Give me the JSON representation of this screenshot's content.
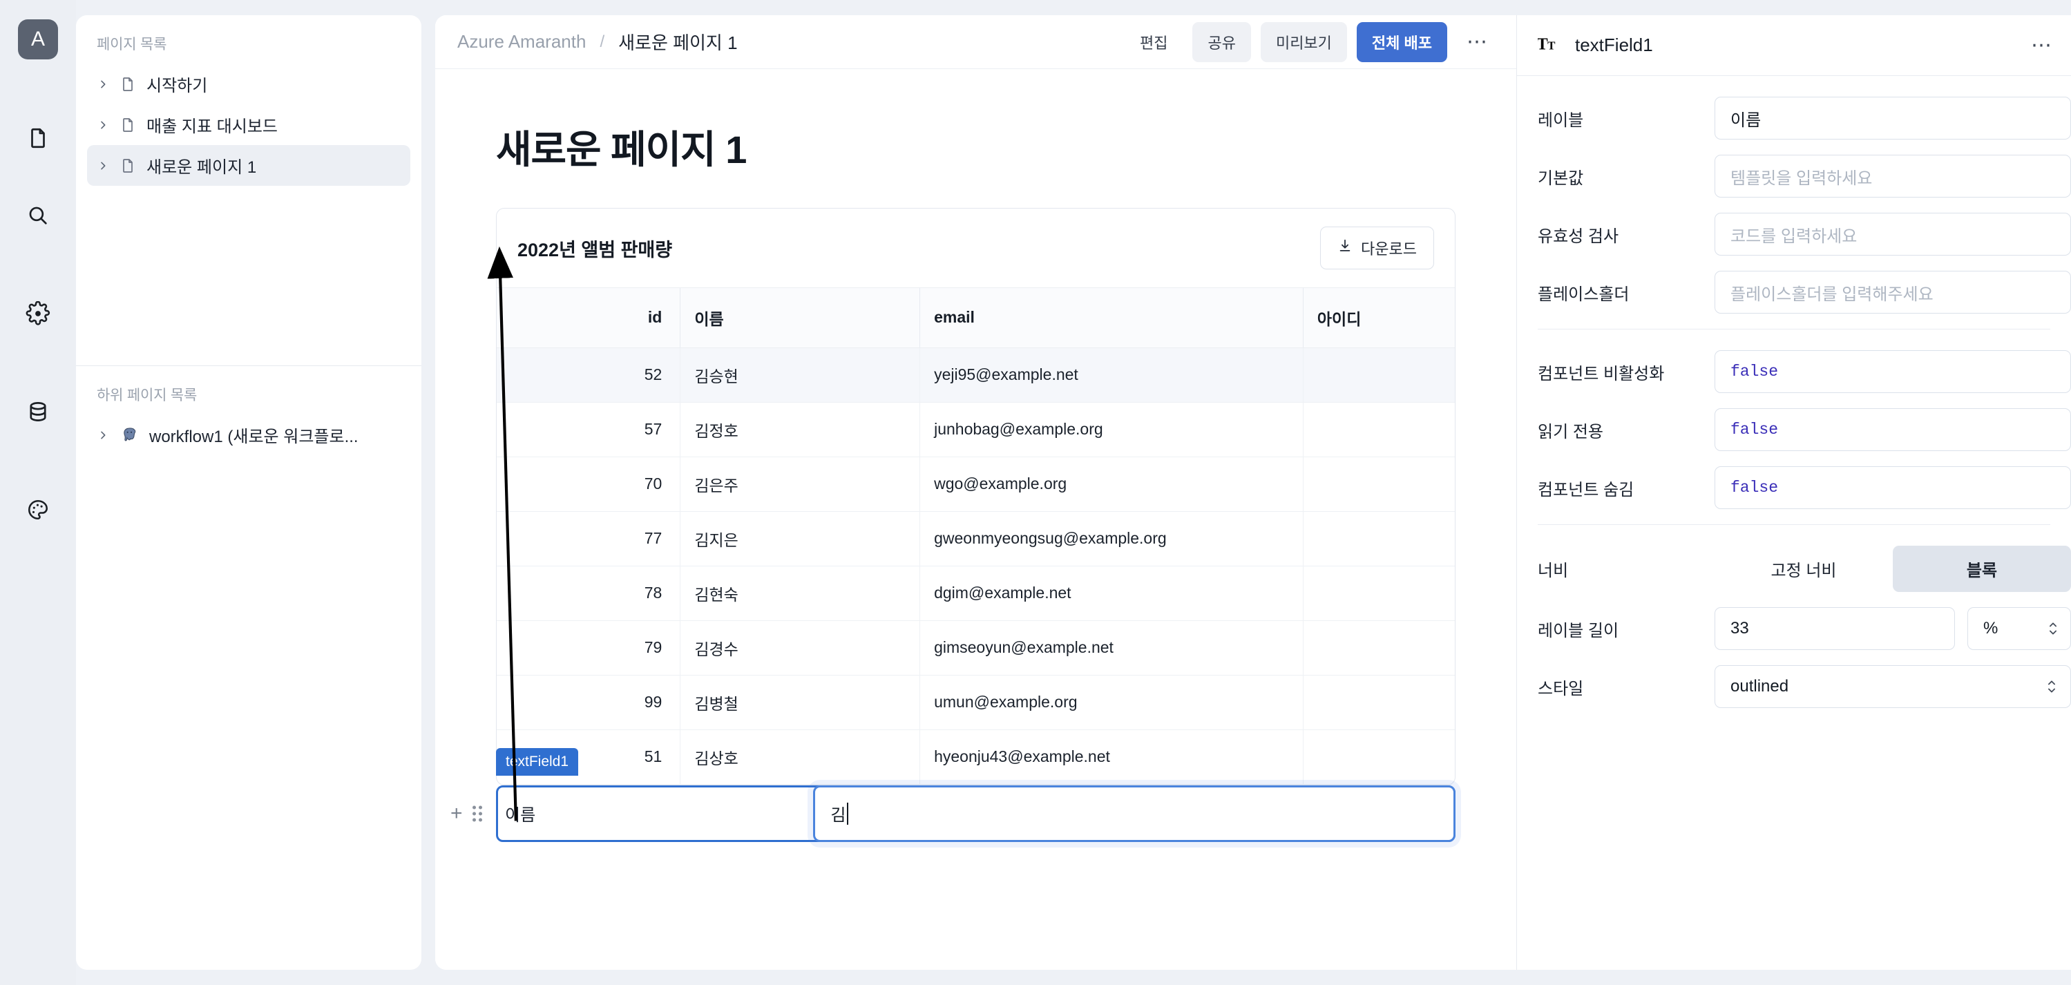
{
  "rail": {
    "logo": "A",
    "items": [
      {
        "name": "document-icon"
      },
      {
        "name": "search-icon"
      },
      {
        "name": "gear-icon"
      },
      {
        "name": "database-icon"
      },
      {
        "name": "palette-icon"
      }
    ]
  },
  "pagelist": {
    "section_title": "페이지 목록",
    "items": [
      {
        "label": "시작하기",
        "selected": false
      },
      {
        "label": "매출 지표 대시보드",
        "selected": false
      },
      {
        "label": "새로운 페이지 1",
        "selected": true
      }
    ],
    "sub_section_title": "하위 페이지 목록",
    "sub_items": [
      {
        "label": "workflow1 (새로운 워크플로..."
      }
    ]
  },
  "topbar": {
    "breadcrumb_app": "Azure Amaranth",
    "breadcrumb_sep": "/",
    "breadcrumb_page": "새로운 페이지 1",
    "edit_label": "편집",
    "share_label": "공유",
    "preview_label": "미리보기",
    "deploy_label": "전체 배포",
    "more_label": "⋯",
    "accent": "#3f6fd1"
  },
  "canvas": {
    "page_title": "새로운 페이지 1",
    "card": {
      "title": "2022년 앨범 판매량",
      "download_label": "다운로드"
    },
    "widget": {
      "badge": "textField1",
      "label": "이름",
      "value": "김"
    }
  },
  "table": {
    "columns": [
      "id",
      "이름",
      "email",
      "아이디"
    ],
    "rows": [
      {
        "id": "52",
        "name": "김승현",
        "email": "yeji95@example.net",
        "aid": ""
      },
      {
        "id": "57",
        "name": "김정호",
        "email": "junhobag@example.org",
        "aid": ""
      },
      {
        "id": "70",
        "name": "김은주",
        "email": "wgo@example.org",
        "aid": ""
      },
      {
        "id": "77",
        "name": "김지은",
        "email": "gweonmyeongsug@example.org",
        "aid": ""
      },
      {
        "id": "78",
        "name": "김현숙",
        "email": "dgim@example.net",
        "aid": ""
      },
      {
        "id": "79",
        "name": "김경수",
        "email": "gimseoyun@example.net",
        "aid": ""
      },
      {
        "id": "99",
        "name": "김병철",
        "email": "umun@example.org",
        "aid": ""
      },
      {
        "id": "51",
        "name": "김상호",
        "email": "hyeonju43@example.net",
        "aid": ""
      }
    ]
  },
  "props": {
    "component_name": "textField1",
    "more_label": "⋯",
    "fields": {
      "label_title": "레이블",
      "label_value": "이름",
      "default_title": "기본값",
      "default_placeholder": "템플릿을 입력하세요",
      "validation_title": "유효성 검사",
      "validation_placeholder": "코드를 입력하세요",
      "placeholder_title": "플레이스홀더",
      "placeholder_placeholder": "플레이스홀더를 입력해주세요",
      "disabled_title": "컴포넌트 비활성화",
      "disabled_value": "false",
      "readonly_title": "읽기 전용",
      "readonly_value": "false",
      "hidden_title": "컴포넌트 숨김",
      "hidden_value": "false",
      "width_title": "너비",
      "width_fixed": "고정 너비",
      "width_block": "블록",
      "label_len_title": "레이블 길이",
      "label_len_value": "33",
      "label_len_unit": "%",
      "style_title": "스타일",
      "style_value": "outlined"
    }
  }
}
